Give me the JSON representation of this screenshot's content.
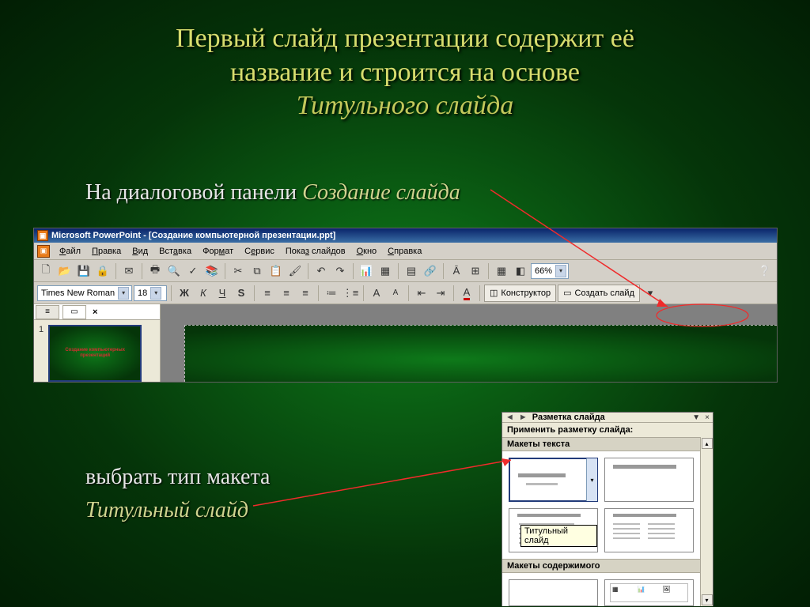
{
  "title": {
    "line1": "Первый слайд презентации содержит её",
    "line2": "название и строится на основе",
    "emph": "Титульного слайда"
  },
  "body1_a": "На диалоговой панели ",
  "body1_b": "Создание слайда",
  "body2": "выбрать тип макета",
  "body3": "Титульный слайд",
  "pp": {
    "title": "Microsoft PowerPoint - [Создание компьютерной презентации.ppt]",
    "menu": [
      "Файл",
      "Правка",
      "Вид",
      "Вставка",
      "Формат",
      "Сервис",
      "Показ слайдов",
      "Окно",
      "Справка"
    ],
    "font": "Times New Roman",
    "fontsize": "18",
    "zoom": "66%",
    "btn_designer": "Конструктор",
    "btn_newslide": "Создать слайд",
    "thumb_num": "1",
    "thumb_text": "Создание компьютерных презентаций"
  },
  "taskpane": {
    "title": "Разметка слайда",
    "apply": "Применить разметку слайда:",
    "sect1": "Макеты текста",
    "sect2": "Макеты содержимого",
    "tooltip": "Титульный слайд"
  }
}
